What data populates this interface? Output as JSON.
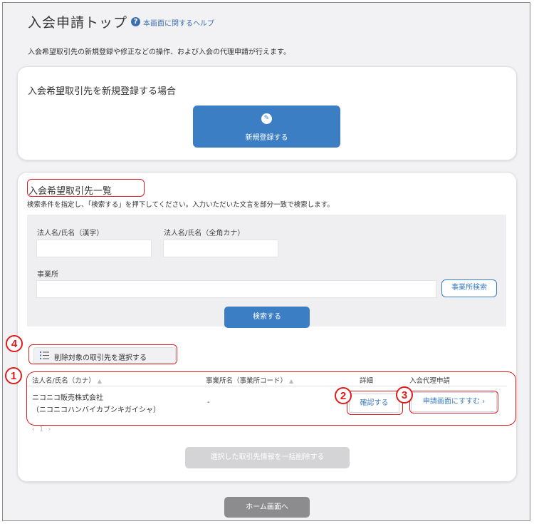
{
  "header": {
    "title": "入会申請トップ",
    "help_icon": "?",
    "help_link": "本画面に関するヘルプ",
    "description": "入会希望取引先の新規登録や修正などの操作、および入会の代理申請が行えます。"
  },
  "new_registration": {
    "section_title": "入会希望取引先を新規登録する場合",
    "button_label": "新規登録する",
    "button_icon": "edit-icon"
  },
  "list_section": {
    "title": "入会希望取引先一覧",
    "description": "検索条件を指定し、「検索する」を押下してください。入力いただいた文言を部分一致で検索します。",
    "search": {
      "name_kanji_label": "法人名/氏名（漢字）",
      "name_kanji_value": "",
      "name_kana_label": "法人名/氏名（全角カナ）",
      "name_kana_value": "",
      "office_label": "事業所",
      "office_value": "",
      "office_search_button": "事業所検索",
      "search_button": "検索する"
    },
    "select_delete_button": "削除対象の取引先を選択する",
    "table": {
      "headers": [
        "法人名/氏名（カナ）",
        "事業所名（事業所コード）",
        "詳細",
        "入会代理申請"
      ],
      "sort_mark": "▲",
      "rows": [
        {
          "name": "ニコニコ販売株式会社",
          "name_kana": "（ニコニコハンバイカブシキガイシャ）",
          "office": "-",
          "detail_button": "確認する",
          "apply_button": "申請画面にすすむ ›"
        }
      ]
    },
    "pagination": [
      "‹",
      "1",
      "›"
    ],
    "bulk_delete_button": "選択した取引先情報を一括削除する"
  },
  "footer": {
    "home_button": "ホーム画面へ"
  },
  "annotations": [
    "1",
    "2",
    "3",
    "4"
  ],
  "colors": {
    "accent": "#3c7ec4",
    "annotation_red": "#e01b1b",
    "disabled": "#d4d4d6",
    "home_button": "#8c8c8e"
  }
}
